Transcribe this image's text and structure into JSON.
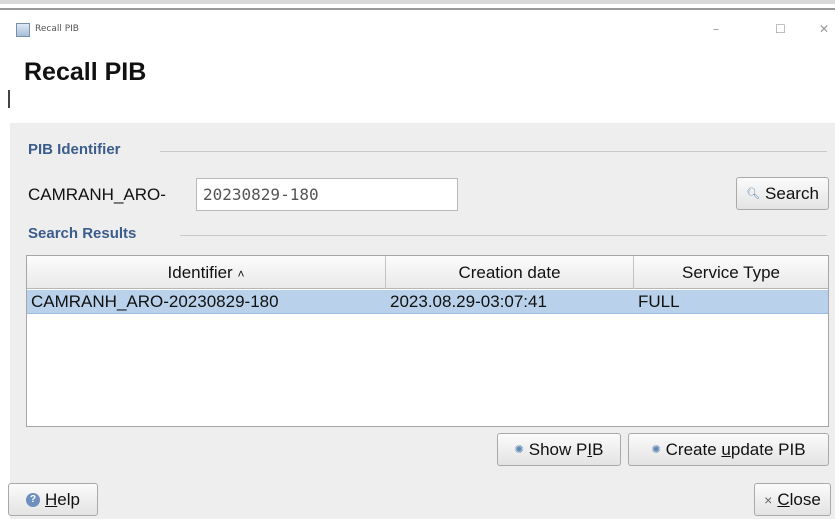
{
  "window": {
    "title": "Recall PIB",
    "controls": {
      "minimize": "–",
      "maximize": "☐",
      "close": "✕"
    },
    "icon": "app-window-icon"
  },
  "page_title": "Recall PIB",
  "pib_identifier": {
    "section_title": "PIB Identifier",
    "prefix": "CAMRANH_ARO-",
    "input_value": "20230829-180",
    "search_button": {
      "label": "Search",
      "icon": "search-icon"
    }
  },
  "search_results": {
    "section_title": "Search Results",
    "columns": [
      "Identifier",
      "Creation date",
      "Service Type"
    ],
    "sort_indicator": "˄",
    "rows": [
      [
        "CAMRANH_ARO-20230829-180",
        "2023.08.29-03:07:41",
        "FULL"
      ]
    ],
    "selected_row": 0
  },
  "actions": {
    "show_pib": {
      "label_pre": "Show P",
      "mnemonic": "I",
      "label_post": "B",
      "icon": "gear-icon"
    },
    "create_update": {
      "label_pre": "Create ",
      "mnemonic": "u",
      "label_post": "pdate PIB",
      "icon": "gear-icon"
    }
  },
  "footer": {
    "help": {
      "mnemonic": "H",
      "label_post": "elp",
      "icon": "help-icon"
    },
    "close": {
      "mnemonic": "C",
      "label_post": "lose",
      "icon": "close-x-icon"
    }
  },
  "colors": {
    "section_title": "#3c5d8c",
    "selected_row": "#b9d1ea",
    "content_bg": "#eeeeee"
  }
}
